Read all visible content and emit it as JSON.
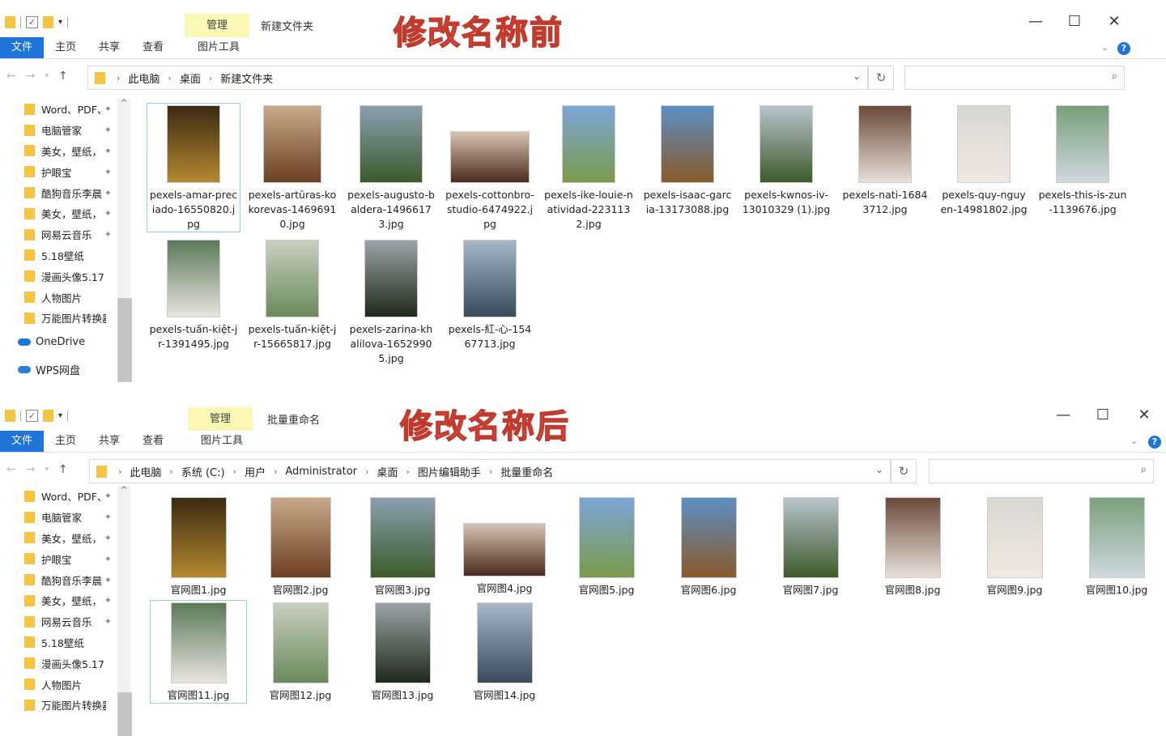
{
  "colors": {
    "accent": "#1e74d8",
    "folder": "#f5c542",
    "ctx_tab": "#fbf7b5"
  },
  "ribbon": {
    "file": "文件",
    "home": "主页",
    "share": "共享",
    "view": "查看",
    "manage": "管理",
    "picture_tools": "图片工具"
  },
  "top": {
    "window_name": "新建文件夹",
    "banner": "修改名称前",
    "breadcrumbs": [
      "此电脑",
      "桌面",
      "新建文件夹"
    ],
    "files": [
      "pexels-amar-preciado-16550820.jpg",
      "pexels-artūras-kokorevas-14696910.jpg",
      "pexels-augusto-baldera-14966173.jpg",
      "pexels-cottonbro-studio-6474922.jpg",
      "pexels-ike-louie-natividad-2231132.jpg",
      "pexels-isaac-garcia-13173088.jpg",
      "pexels-kwnos-iv-13010329 (1).jpg",
      "pexels-nati-16843712.jpg",
      "pexels-quy-nguyen-14981802.jpg",
      "pexels-this-is-zun-1139676.jpg",
      "pexels-tuấn-kiệt-jr-1391495.jpg",
      "pexels-tuấn-kiệt-jr-15665817.jpg",
      "pexels-zarina-khalilova-16529905.jpg",
      "pexels-紅-心-15467713.jpg"
    ]
  },
  "bottom": {
    "window_name": "批量重命名",
    "banner": "修改名称后",
    "breadcrumbs": [
      "此电脑",
      "系统 (C:)",
      "用户",
      "Administrator",
      "桌面",
      "图片编辑助手",
      "批量重命名"
    ],
    "files": [
      "官网图1.jpg",
      "官网图2.jpg",
      "官网图3.jpg",
      "官网图4.jpg",
      "官网图5.jpg",
      "官网图6.jpg",
      "官网图7.jpg",
      "官网图8.jpg",
      "官网图9.jpg",
      "官网图10.jpg",
      "官网图11.jpg",
      "官网图12.jpg",
      "官网图13.jpg",
      "官网图14.jpg"
    ]
  },
  "sidebar": {
    "items": [
      "Word、PDF、",
      "电脑管家",
      "美女，壁纸，",
      "护眼宝",
      "酷狗音乐李晨",
      "美女，壁纸，",
      "网易云音乐",
      "5.18壁纸",
      "漫画头像5.17",
      "人物图片",
      "万能图片转换器"
    ],
    "onedrive": "OneDrive",
    "wps": "WPS网盘"
  }
}
